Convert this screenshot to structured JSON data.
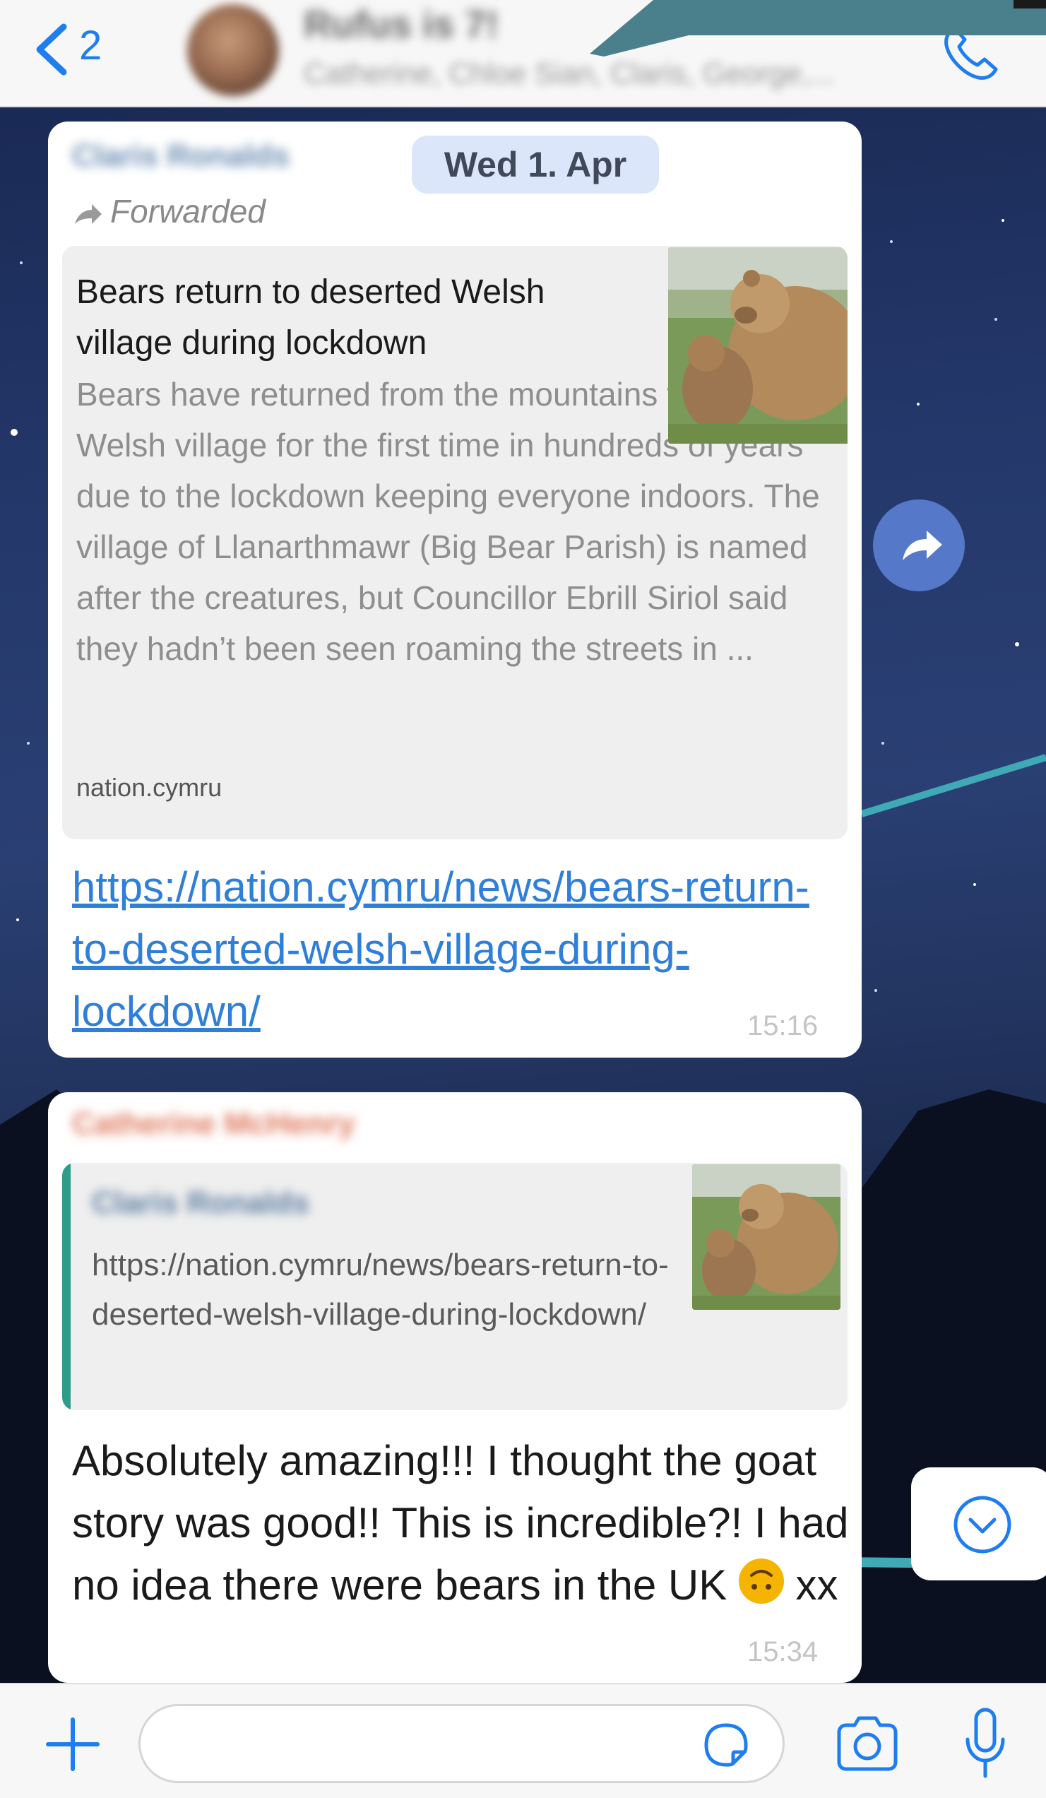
{
  "header": {
    "back_count": "2",
    "chat_title": "Rufus is 7!",
    "chat_subtitle": "Catherine, Chloe Sian, Claris, George,..."
  },
  "messages": [
    {
      "sender": "Claris Ronalds",
      "date_chip": "Wed 1. Apr",
      "forwarded_label": "Forwarded",
      "link_preview": {
        "title": "Bears return to deserted Welsh village during lockdown",
        "description": "Bears have returned from the mountains to one Welsh village for the first time in hundreds of years due to the lockdown keeping everyone indoors. The village of Llanarthmawr (Big Bear Parish) is named after the creatures, but Councillor Ebrill Siriol said they hadn’t been seen roaming the streets in ...",
        "domain": "nation.cymru"
      },
      "url": "https://nation.cymru/news/bears-return-to-deserted-welsh-village-during-lockdown/",
      "time": "15:16"
    },
    {
      "sender": "Catherine McHenry",
      "quote": {
        "sender": "Claris Ronalds",
        "text": "https://nation.cymru/news/bears-return-to-deserted-welsh-village-during-lockdown/"
      },
      "text_before_emoji": "Absolutely amazing!!! I thought the goat story was good!! This is incredible?! I had no idea there were bears in the UK ",
      "text_after_emoji": " xx",
      "emoji": "upside-down-face",
      "time": "15:34"
    }
  ],
  "input": {
    "placeholder": "",
    "value": ""
  },
  "colors": {
    "accent": "#1e7ef0",
    "link": "#2f7fd9",
    "annotation_teal": "#4a7f8c",
    "quote_bar": "#2f9b8b",
    "share_button": "#5578c9"
  },
  "icons": [
    "back-chevron-icon",
    "phone-call-icon",
    "share-forward-icon",
    "scroll-down-icon",
    "plus-icon",
    "sticker-icon",
    "camera-icon",
    "microphone-icon"
  ]
}
